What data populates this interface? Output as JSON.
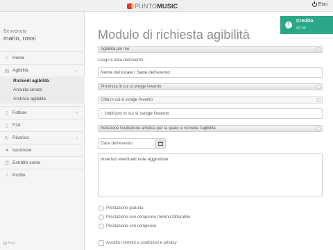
{
  "header": {
    "logo_left": "PUNTO",
    "logo_right": "MUSIC",
    "exit_label": "Esci"
  },
  "sidebar": {
    "welcome": "Benvenuto",
    "username": "mario, rossi",
    "items": [
      {
        "label": "Home",
        "icon": "home-icon"
      },
      {
        "label": "Agibilità",
        "icon": "document-icon"
      },
      {
        "label": "Fatture",
        "icon": "invoice-icon"
      },
      {
        "label": "F24",
        "icon": "file-icon"
      },
      {
        "label": "Ricarica",
        "icon": "refresh-icon"
      },
      {
        "label": "Iscrizione",
        "icon": "user-icon"
      },
      {
        "label": "Estratto conto",
        "icon": "list-icon"
      },
      {
        "label": "Profilo",
        "icon": "info-icon"
      }
    ],
    "subitems": [
      {
        "label": "Richiedi agibilità"
      },
      {
        "label": "Annulla serata"
      },
      {
        "label": "Archivio agibilità"
      }
    ],
    "exit_label": "Esci"
  },
  "form": {
    "title": "Modulo di richiesta agibilità",
    "agibility_select": "Agibilità per me",
    "place_date_label": "Luogo e data dell'evento:",
    "venue_placeholder": "Nome del locale / Sede dell'evento",
    "province_select": "Provincia in cui si svolge l'evento",
    "city_select": "Città in cui si svolge l'evento",
    "address_placeholder": "Indirizzo in cui si svolge l'evento",
    "performance_select": "Selezione l'esibizione artistica per la quale si richiede l'agibilità",
    "date_placeholder": "Data dell'evento",
    "notes_placeholder": "Inserisci eventuali note aggiuntive",
    "radios": [
      {
        "label": "Prestazione gratuita"
      },
      {
        "label": "Prestazione con compenso minimo fatturabile"
      },
      {
        "label": "Prestazione con compenso"
      }
    ],
    "terms_label": "Accetto i termini e condizioni e privacy"
  },
  "notification": {
    "title": "Credito",
    "value": "€0,00"
  },
  "colors": {
    "accent": "#2aa789",
    "sidebar_bg": "#f5f5f5"
  }
}
